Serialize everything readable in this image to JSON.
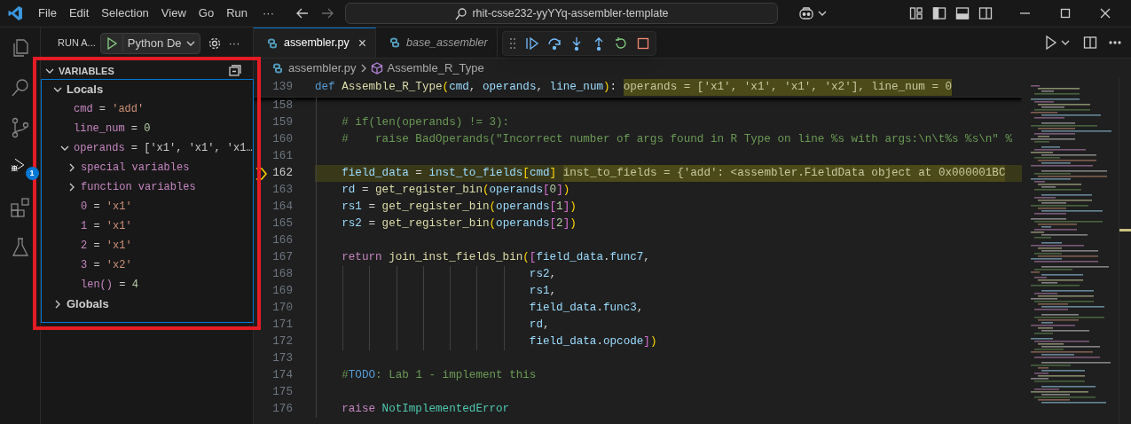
{
  "title_bar": {
    "menu": [
      "File",
      "Edit",
      "Selection",
      "View",
      "Go",
      "Run"
    ],
    "overflow": "···",
    "search": "rhit-csse232-yyYYq-assembler-template"
  },
  "activity_bar": [
    {
      "selected": false
    },
    {
      "selected": false
    },
    {
      "selected": false
    },
    {
      "selected": true,
      "badge": "1"
    },
    {
      "selected": false
    },
    {
      "selected": false
    }
  ],
  "sidebar": {
    "title": "RUN A...",
    "configuration": "Python De",
    "more": "···",
    "variables": {
      "title": "VARIABLES",
      "tree": [
        {
          "kind": "scope",
          "label": "Locals",
          "expanded": true,
          "children": [
            {
              "kind": "variable",
              "segments": [
                {
                  "text": "cmd",
                  "kind": "name"
                },
                {
                  "text": " = ",
                  "kind": "plain"
                },
                {
                  "text": "'add'",
                  "kind": "string"
                }
              ]
            },
            {
              "kind": "variable",
              "segments": [
                {
                  "text": "line_num",
                  "kind": "name"
                },
                {
                  "text": " = ",
                  "kind": "plain"
                },
                {
                  "text": "0",
                  "kind": "number"
                }
              ]
            },
            {
              "kind": "variable",
              "expanded": true,
              "segments": [
                {
                  "text": "operands",
                  "kind": "name"
                },
                {
                  "text": " = ",
                  "kind": "plain"
                },
                {
                  "text": "['x1', 'x1', 'x1…",
                  "kind": "plain"
                }
              ],
              "children": [
                {
                  "kind": "group",
                  "label": "special variables",
                  "expanded": false
                },
                {
                  "kind": "group",
                  "label": "function variables",
                  "expanded": false
                },
                {
                  "kind": "variable",
                  "segments": [
                    {
                      "text": "0",
                      "kind": "name"
                    },
                    {
                      "text": " = ",
                      "kind": "plain"
                    },
                    {
                      "text": "'x1'",
                      "kind": "string"
                    }
                  ]
                },
                {
                  "kind": "variable",
                  "segments": [
                    {
                      "text": "1",
                      "kind": "name"
                    },
                    {
                      "text": " = ",
                      "kind": "plain"
                    },
                    {
                      "text": "'x1'",
                      "kind": "string"
                    }
                  ]
                },
                {
                  "kind": "variable",
                  "segments": [
                    {
                      "text": "2",
                      "kind": "name"
                    },
                    {
                      "text": " = ",
                      "kind": "plain"
                    },
                    {
                      "text": "'x1'",
                      "kind": "string"
                    }
                  ]
                },
                {
                  "kind": "variable",
                  "segments": [
                    {
                      "text": "3",
                      "kind": "name"
                    },
                    {
                      "text": " = ",
                      "kind": "plain"
                    },
                    {
                      "text": "'x2'",
                      "kind": "string"
                    }
                  ]
                },
                {
                  "kind": "variable",
                  "segments": [
                    {
                      "text": "len()",
                      "kind": "name"
                    },
                    {
                      "text": " = ",
                      "kind": "plain"
                    },
                    {
                      "text": "4",
                      "kind": "number"
                    }
                  ]
                }
              ]
            }
          ]
        },
        {
          "kind": "scope",
          "label": "Globals",
          "expanded": false
        }
      ]
    }
  },
  "editor": {
    "tabs": [
      {
        "label": "assembler.py",
        "selected": true,
        "close": "×"
      },
      {
        "label": "base_assembler",
        "selected": false
      }
    ],
    "breadcrumbs": [
      "assembler.py",
      "Assemble_R_Type"
    ],
    "sticky_line": {
      "number": "139",
      "segments": [
        {
          "text": "def ",
          "kind": "kw"
        },
        {
          "text": "Assemble_R_Type",
          "kind": "fn"
        },
        {
          "text": "(",
          "kind": "b1"
        },
        {
          "text": "cmd",
          "kind": "var"
        },
        {
          "text": ", ",
          "kind": "plain"
        },
        {
          "text": "operands",
          "kind": "var"
        },
        {
          "text": ", ",
          "kind": "plain"
        },
        {
          "text": "line_num",
          "kind": "var"
        },
        {
          "text": ")",
          "kind": "b1"
        },
        {
          "text": ": ",
          "kind": "plain"
        },
        {
          "text": "operands = ['x1', 'x1', 'x1', 'x2'], line_num = 0",
          "kind": "inline"
        }
      ]
    },
    "lines": [
      {
        "number": "158",
        "current": false
      },
      {
        "number": "159",
        "current": false,
        "segments": [
          {
            "text": "    # if(len(operands) != 3):",
            "kind": "comment"
          }
        ]
      },
      {
        "number": "160",
        "current": false,
        "segments": [
          {
            "text": "    #    raise BadOperands(\"Incorrect number of args found in R Type on line %s with args:\\n\\t%s %s\\n\" %",
            "kind": "comment"
          }
        ]
      },
      {
        "number": "161",
        "current": false
      },
      {
        "number": "162",
        "current": true,
        "segments": [
          {
            "text": "    field_data",
            "kind": "var"
          },
          {
            "text": " = ",
            "kind": "plain"
          },
          {
            "text": "inst_to_fields",
            "kind": "var"
          },
          {
            "text": "[",
            "kind": "b1"
          },
          {
            "text": "cmd",
            "kind": "var"
          },
          {
            "text": "] ",
            "kind": "b1"
          },
          {
            "text": "inst_to_fields = {'add': <assembler.FieldData object at 0x000001BC",
            "kind": "inline"
          }
        ]
      },
      {
        "number": "163",
        "current": false,
        "segments": [
          {
            "text": "    rd",
            "kind": "var"
          },
          {
            "text": " = ",
            "kind": "plain"
          },
          {
            "text": "get_register_bin",
            "kind": "fn"
          },
          {
            "text": "(",
            "kind": "b1"
          },
          {
            "text": "operands",
            "kind": "var"
          },
          {
            "text": "[",
            "kind": "b2"
          },
          {
            "text": "0",
            "kind": "num"
          },
          {
            "text": "]",
            "kind": "b2"
          },
          {
            "text": ")",
            "kind": "b1"
          }
        ]
      },
      {
        "number": "164",
        "current": false,
        "segments": [
          {
            "text": "    rs1",
            "kind": "var"
          },
          {
            "text": " = ",
            "kind": "plain"
          },
          {
            "text": "get_register_bin",
            "kind": "fn"
          },
          {
            "text": "(",
            "kind": "b1"
          },
          {
            "text": "operands",
            "kind": "var"
          },
          {
            "text": "[",
            "kind": "b2"
          },
          {
            "text": "1",
            "kind": "num"
          },
          {
            "text": "]",
            "kind": "b2"
          },
          {
            "text": ")",
            "kind": "b1"
          }
        ]
      },
      {
        "number": "165",
        "current": false,
        "segments": [
          {
            "text": "    rs2",
            "kind": "var"
          },
          {
            "text": " = ",
            "kind": "plain"
          },
          {
            "text": "get_register_bin",
            "kind": "fn"
          },
          {
            "text": "(",
            "kind": "b1"
          },
          {
            "text": "operands",
            "kind": "var"
          },
          {
            "text": "[",
            "kind": "b2"
          },
          {
            "text": "2",
            "kind": "num"
          },
          {
            "text": "]",
            "kind": "b2"
          },
          {
            "text": ")",
            "kind": "b1"
          }
        ]
      },
      {
        "number": "166",
        "current": false
      },
      {
        "number": "167",
        "current": false,
        "segments": [
          {
            "text": "    return ",
            "kind": "ctrl"
          },
          {
            "text": "join_inst_fields_bin",
            "kind": "fn"
          },
          {
            "text": "(",
            "kind": "b1"
          },
          {
            "text": "[",
            "kind": "b2"
          },
          {
            "text": "field_data",
            "kind": "var"
          },
          {
            "text": ".",
            "kind": "plain"
          },
          {
            "text": "func7",
            "kind": "var"
          },
          {
            "text": ",",
            "kind": "plain"
          }
        ]
      },
      {
        "number": "168",
        "current": false,
        "segments": [
          {
            "text": "                                rs2",
            "kind": "var"
          },
          {
            "text": ",",
            "kind": "plain"
          }
        ]
      },
      {
        "number": "169",
        "current": false,
        "segments": [
          {
            "text": "                                rs1",
            "kind": "var"
          },
          {
            "text": ",",
            "kind": "plain"
          }
        ]
      },
      {
        "number": "170",
        "current": false,
        "segments": [
          {
            "text": "                                field_data",
            "kind": "var"
          },
          {
            "text": ".",
            "kind": "plain"
          },
          {
            "text": "func3",
            "kind": "var"
          },
          {
            "text": ",",
            "kind": "plain"
          }
        ]
      },
      {
        "number": "171",
        "current": false,
        "segments": [
          {
            "text": "                                rd",
            "kind": "var"
          },
          {
            "text": ",",
            "kind": "plain"
          }
        ]
      },
      {
        "number": "172",
        "current": false,
        "segments": [
          {
            "text": "                                field_data",
            "kind": "var"
          },
          {
            "text": ".",
            "kind": "plain"
          },
          {
            "text": "opcode",
            "kind": "var"
          },
          {
            "text": "]",
            "kind": "b2"
          },
          {
            "text": ")",
            "kind": "b1"
          }
        ]
      },
      {
        "number": "173",
        "current": false
      },
      {
        "number": "174",
        "current": false,
        "segments": [
          {
            "text": "    #",
            "kind": "comment"
          },
          {
            "text": "TODO",
            "kind": "todo"
          },
          {
            "text": ": Lab 1 - implement this",
            "kind": "comment"
          }
        ]
      },
      {
        "number": "175",
        "current": false
      },
      {
        "number": "176",
        "current": false,
        "segments": [
          {
            "text": "    raise ",
            "kind": "ctrl"
          },
          {
            "text": "NotImplementedError",
            "kind": "cls"
          }
        ]
      }
    ]
  }
}
